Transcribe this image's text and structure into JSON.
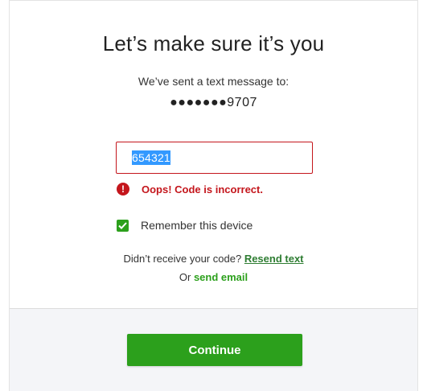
{
  "heading": "Let’s make sure it’s you",
  "subtitle": "We’ve sent a text message to:",
  "phone": "●●●●●●●9707",
  "code_input": {
    "value": "654321"
  },
  "error": {
    "icon": "exclamation-icon",
    "message": "Oops! Code is incorrect."
  },
  "remember": {
    "checked": true,
    "label": "Remember this device"
  },
  "resend": {
    "prompt": "Didn’t receive your code?",
    "link": "Resend text"
  },
  "email": {
    "prompt": "Or",
    "link": "send email"
  },
  "continue_label": "Continue",
  "colors": {
    "accent": "#2ca01c",
    "error": "#c4161c",
    "selection": "#3399ff"
  }
}
